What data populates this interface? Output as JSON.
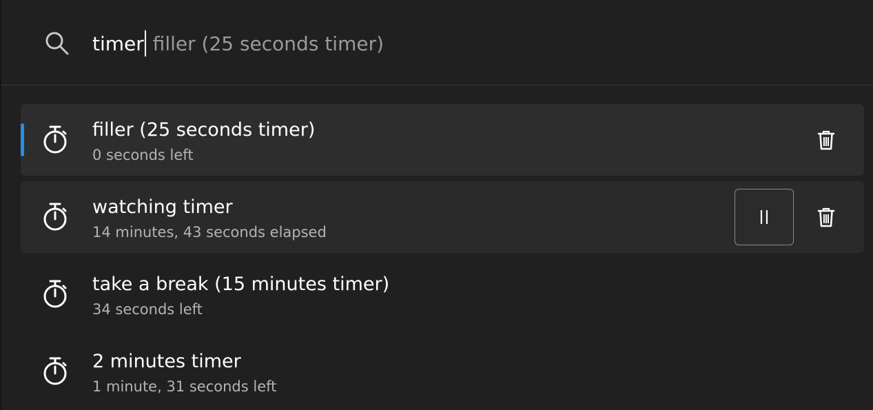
{
  "search": {
    "typed": "timer",
    "suggestion": " filler (25 seconds timer)",
    "icon": "search-icon"
  },
  "results": [
    {
      "title": "filler (25 seconds timer)",
      "subtitle": "0 seconds left",
      "icon": "stopwatch-icon",
      "selected": true,
      "actions": [
        "delete"
      ]
    },
    {
      "title": "watching timer",
      "subtitle": "14 minutes, 43 seconds elapsed",
      "icon": "stopwatch-icon",
      "selected": false,
      "actions": [
        "pause",
        "delete"
      ]
    },
    {
      "title": "take a break (15 minutes timer)",
      "subtitle": "34 seconds left",
      "icon": "stopwatch-icon",
      "selected": false,
      "actions": []
    },
    {
      "title": "2 minutes timer",
      "subtitle": "1 minute, 31 seconds left",
      "icon": "stopwatch-icon",
      "selected": false,
      "actions": []
    }
  ],
  "colors": {
    "background": "#202020",
    "accent": "#2b8ee6",
    "primary_text": "#ffffff",
    "secondary_text": "#b4b4b4",
    "suggestion_text": "#9a9a9a"
  }
}
